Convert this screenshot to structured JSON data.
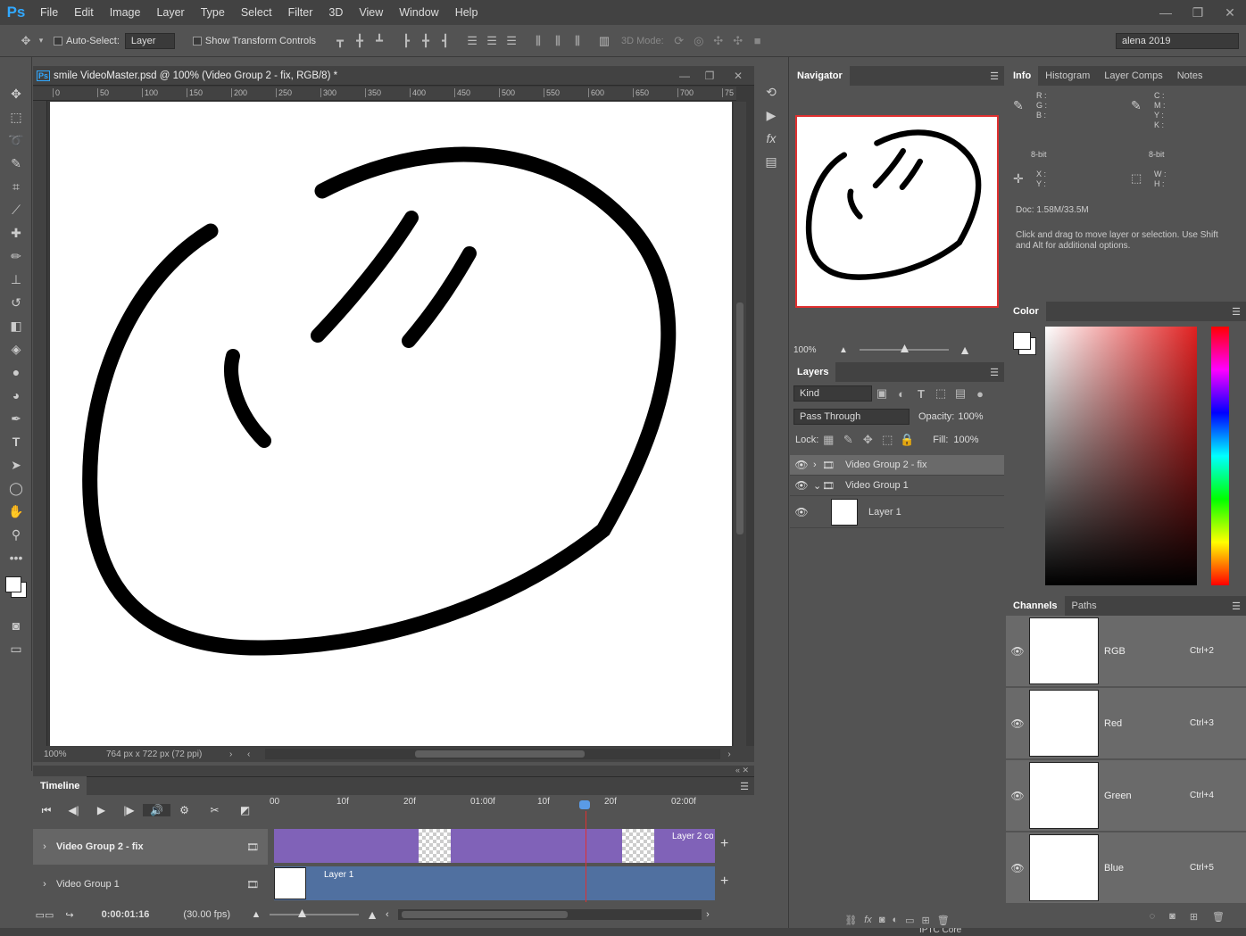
{
  "app": {
    "logo": "Ps"
  },
  "menu": [
    "File",
    "Edit",
    "Image",
    "Layer",
    "Type",
    "Select",
    "Filter",
    "3D",
    "View",
    "Window",
    "Help"
  ],
  "window_controls": [
    "—",
    "❐",
    "✕"
  ],
  "options": {
    "auto_select_label": "Auto-Select:",
    "auto_select_value": "Layer",
    "transform_label": "Show Transform Controls",
    "mode_3d": "3D Mode:",
    "workspace": "alena 2019"
  },
  "document": {
    "title": "smile VideoMaster.psd @ 100% (Video Group 2 - fix, RGB/8) *",
    "zoom": "100%",
    "size_info": "764 px x 722 px (72 ppi)",
    "ruler_ticks": [
      "0",
      "50",
      "100",
      "150",
      "200",
      "250",
      "300",
      "350",
      "400",
      "450",
      "500",
      "550",
      "600",
      "650",
      "700",
      "75"
    ]
  },
  "timeline": {
    "title": "Timeline",
    "time_labels": [
      "00",
      "10f",
      "20f",
      "01:00f",
      "10f",
      "20f",
      "02:00f"
    ],
    "tracks": [
      {
        "name": "Video Group 2 - fix",
        "clip_label": "Layer 2 cop"
      },
      {
        "name": "Video Group 1",
        "clip_label": "Layer 1"
      }
    ],
    "current_time": "0:00:01:16",
    "fps": "(30.00 fps)"
  },
  "navigator": {
    "title": "Navigator",
    "zoom": "100%"
  },
  "layers": {
    "title": "Layers",
    "kind": "Kind",
    "blend": "Pass Through",
    "opacity_label": "Opacity:",
    "opacity": "100%",
    "lock_label": "Lock:",
    "fill_label": "Fill:",
    "fill": "100%",
    "items": [
      {
        "name": "Video Group 2 - fix",
        "type": "group"
      },
      {
        "name": "Video Group 1",
        "type": "group"
      },
      {
        "name": "Layer 1",
        "type": "layer"
      }
    ]
  },
  "info": {
    "tabs": [
      "Info",
      "Histogram",
      "Layer Comps",
      "Notes"
    ],
    "rgb": "R :\nG :\nB :",
    "cmyk": "C :\nM :\nY :\nK :",
    "bit_left": "8-bit",
    "bit_right": "8-bit",
    "xy": "X :\nY :",
    "wh": "W :\nH :",
    "doc": "Doc: 1.58M/33.5M",
    "hint": "Click and drag to move layer or selection.  Use Shift and Alt for additional options."
  },
  "color_panel": {
    "title": "Color"
  },
  "channels": {
    "tabs": [
      "Channels",
      "Paths"
    ],
    "items": [
      {
        "name": "RGB",
        "shortcut": "Ctrl+2"
      },
      {
        "name": "Red",
        "shortcut": "Ctrl+3"
      },
      {
        "name": "Green",
        "shortcut": "Ctrl+4"
      },
      {
        "name": "Blue",
        "shortcut": "Ctrl+5"
      }
    ]
  },
  "bottom_peek": "IPTC Core"
}
